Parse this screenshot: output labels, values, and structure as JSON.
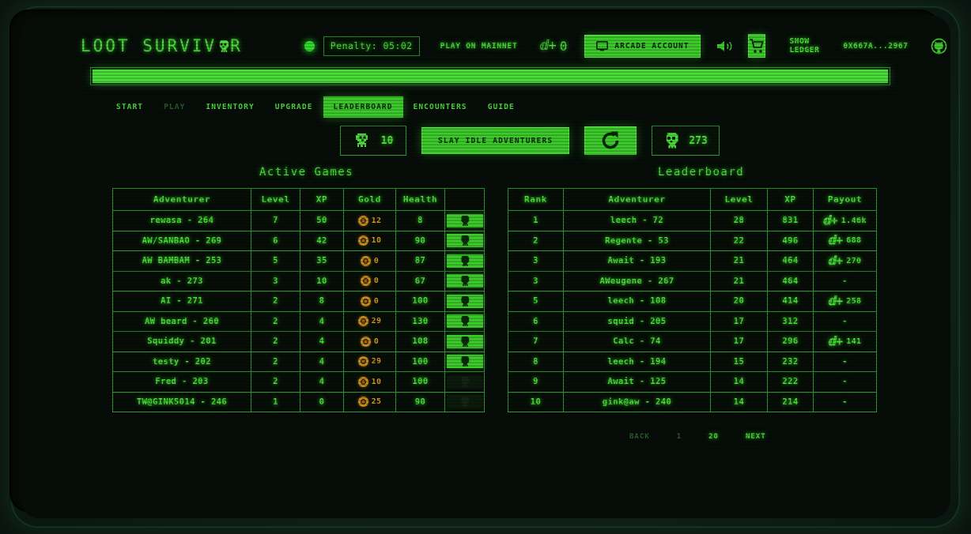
{
  "header": {
    "brand_prefix": "LOOT SURVIV",
    "brand_suffix": "R",
    "brand_skull_icon": "skull-icon",
    "status_dot": "status-dot-online",
    "penalty": "Penalty: 05:02",
    "mainnet_link": "PLAY ON MAINNET",
    "lords_icon": "lords-icon",
    "lords_balance": "0",
    "arcade_account": "ARCADE ACCOUNT",
    "arcade_icon": "monitor-icon",
    "sound_icon": "speaker-icon",
    "cart_icon": "cart-icon",
    "show_ledger": "SHOW LEDGER",
    "wallet_address": "0X667A...2967",
    "github_icon": "github-icon"
  },
  "topbar": {
    "fill_percent": 100
  },
  "nav": {
    "items": [
      {
        "label": "START",
        "state": "normal"
      },
      {
        "label": "PLAY",
        "state": "disabled"
      },
      {
        "label": "INVENTORY",
        "state": "normal"
      },
      {
        "label": "UPGRADE",
        "state": "normal"
      },
      {
        "label": "LEADERBOARD",
        "state": "active"
      },
      {
        "label": "ENCOUNTERS",
        "state": "normal"
      },
      {
        "label": "GUIDE",
        "state": "normal"
      }
    ]
  },
  "actions": {
    "idle_icon": "adventurer-icon",
    "idle_count": "10",
    "slay_label": "SLAY IDLE ADVENTURERS",
    "refresh_icon": "refresh-icon",
    "skull_icon": "skull-icon",
    "skull_count": "273"
  },
  "active_games": {
    "title": "Active Games",
    "columns": [
      "Adventurer",
      "Level",
      "XP",
      "Gold",
      "Health",
      ""
    ],
    "rows": [
      {
        "adventurer": "rewasa - 264",
        "level": "7",
        "xp": "50",
        "gold": "12",
        "health": "8",
        "kill": true
      },
      {
        "adventurer": "AW/SANBAO - 269",
        "level": "6",
        "xp": "42",
        "gold": "10",
        "health": "90",
        "kill": true
      },
      {
        "adventurer": "AW BAMBAM - 253",
        "level": "5",
        "xp": "35",
        "gold": "0",
        "health": "87",
        "kill": true
      },
      {
        "adventurer": "ak - 273",
        "level": "3",
        "xp": "10",
        "gold": "0",
        "health": "67",
        "kill": true
      },
      {
        "adventurer": "AI - 271",
        "level": "2",
        "xp": "8",
        "gold": "0",
        "health": "100",
        "kill": true
      },
      {
        "adventurer": "AW beard - 260",
        "level": "2",
        "xp": "4",
        "gold": "29",
        "health": "130",
        "kill": true
      },
      {
        "adventurer": "Squiddy - 201",
        "level": "2",
        "xp": "4",
        "gold": "0",
        "health": "108",
        "kill": true
      },
      {
        "adventurer": "testy - 202",
        "level": "2",
        "xp": "4",
        "gold": "29",
        "health": "100",
        "kill": true
      },
      {
        "adventurer": "Fred - 203",
        "level": "2",
        "xp": "4",
        "gold": "10",
        "health": "100",
        "kill": false
      },
      {
        "adventurer": "TW@GINK5014 - 246",
        "level": "1",
        "xp": "0",
        "gold": "25",
        "health": "90",
        "kill": false
      }
    ]
  },
  "leaderboard": {
    "title": "Leaderboard",
    "columns": [
      "Rank",
      "Adventurer",
      "Level",
      "XP",
      "Payout"
    ],
    "rows": [
      {
        "rank": "1",
        "adventurer": "leech - 72",
        "level": "28",
        "xp": "831",
        "payout": "1.46k"
      },
      {
        "rank": "2",
        "adventurer": "Regente - 53",
        "level": "22",
        "xp": "496",
        "payout": "688"
      },
      {
        "rank": "3",
        "adventurer": "Await - 193",
        "level": "21",
        "xp": "464",
        "payout": "270"
      },
      {
        "rank": "3",
        "adventurer": "AWeugene - 267",
        "level": "21",
        "xp": "464",
        "payout": "-"
      },
      {
        "rank": "5",
        "adventurer": "leech - 108",
        "level": "20",
        "xp": "414",
        "payout": "258"
      },
      {
        "rank": "6",
        "adventurer": "squid - 205",
        "level": "17",
        "xp": "312",
        "payout": "-"
      },
      {
        "rank": "7",
        "adventurer": "Calc - 74",
        "level": "17",
        "xp": "296",
        "payout": "141"
      },
      {
        "rank": "8",
        "adventurer": "leech - 194",
        "level": "15",
        "xp": "232",
        "payout": "-"
      },
      {
        "rank": "9",
        "adventurer": "Await - 125",
        "level": "14",
        "xp": "222",
        "payout": "-"
      },
      {
        "rank": "10",
        "adventurer": "gink@aw - 240",
        "level": "14",
        "xp": "214",
        "payout": "-"
      }
    ]
  },
  "pager": {
    "back": "BACK",
    "page_current": "1",
    "page_total": "20",
    "next": "NEXT"
  },
  "colors": {
    "accent": "#4ade3a",
    "accent_solid": "#3dcb2c",
    "border": "#2f9a33",
    "gold": "#d79a22",
    "bg": "#060d08",
    "dim": "#2a5c2a"
  }
}
